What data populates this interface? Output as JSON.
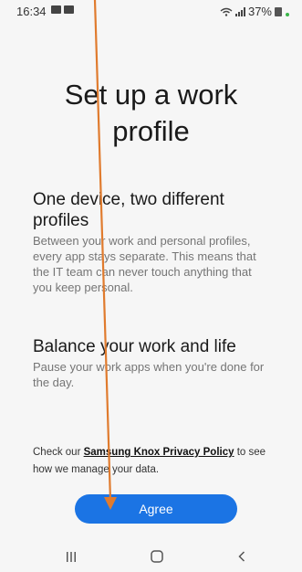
{
  "status_bar": {
    "time": "16:34",
    "battery": "37%"
  },
  "title": "Set up a work profile",
  "sections": [
    {
      "heading": "One device, two different profiles",
      "body": "Between your work and personal profiles, every app stays separate. This means that the IT team can never touch anything that you keep personal."
    },
    {
      "heading": "Balance your work and life",
      "body": "Pause your work apps when you're done for the day."
    }
  ],
  "privacy": {
    "prefix": "Check our ",
    "link_label": "Samsung Knox Privacy Policy",
    "suffix": " to see how we manage your data."
  },
  "agree_label": "Agree",
  "colors": {
    "accent": "#1b74e4",
    "annotation_arrow": "#e07b2e"
  },
  "icons": {
    "nav_recents": "recents-icon",
    "nav_home": "home-icon",
    "nav_back": "back-icon"
  }
}
